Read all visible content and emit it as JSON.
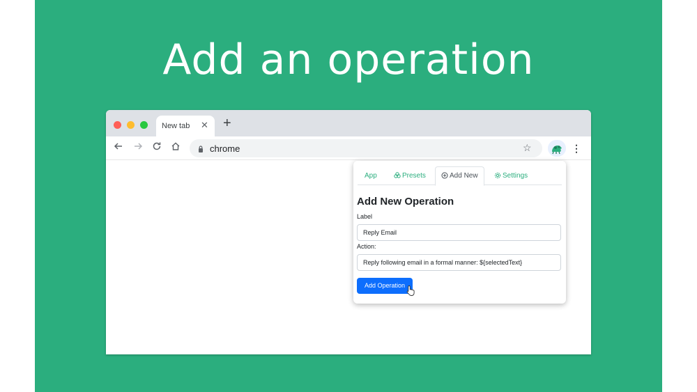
{
  "headline": "Add an operation",
  "colors": {
    "background": "#2bae7e",
    "accent": "#2bae7e",
    "primary_button": "#0d6efd"
  },
  "browser": {
    "tab_title": "New tab",
    "url": "chrome"
  },
  "popup": {
    "tabs": [
      {
        "label": "App",
        "icon": ""
      },
      {
        "label": "Presets",
        "icon": "presets-icon"
      },
      {
        "label": "Add New",
        "icon": "plus-circle-icon"
      },
      {
        "label": "Settings",
        "icon": "gear-icon"
      }
    ],
    "active_tab": "Add New",
    "title": "Add New Operation",
    "label_field": {
      "label": "Label",
      "value": "Reply Email"
    },
    "action_field": {
      "label": "Action:",
      "value": "Reply following email in a formal manner: ${selectedText}"
    },
    "submit_label": "Add Operation"
  }
}
